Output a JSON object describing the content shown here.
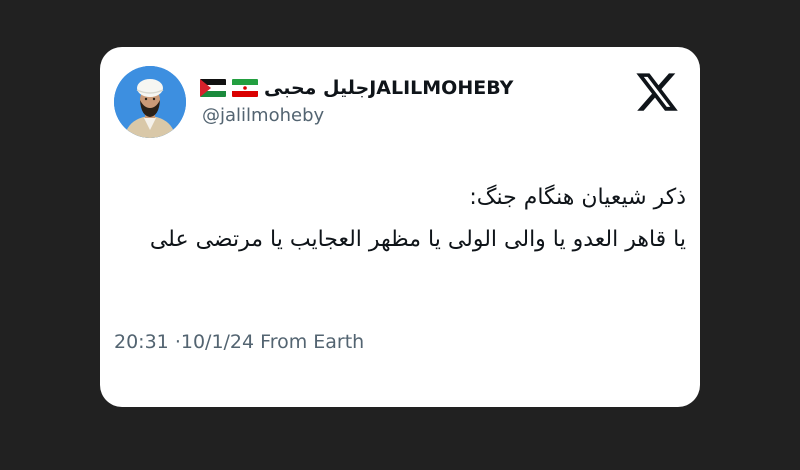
{
  "tweet": {
    "display_name": "جلیل محبیJALILMOHEBY",
    "flags": [
      "iran-flag",
      "palestine-flag"
    ],
    "handle": "@jalilmoheby",
    "text_lines": [
      "ذکر شیعیان هنگام جنگ:",
      "یا قاهر العدو یا والی الولی یا مظهر العجایب یا مرتضی علی"
    ],
    "time": "20:31",
    "separator": "·",
    "date": "10/1/24",
    "location": "From Earth"
  },
  "icons": {
    "brand": "x-logo-icon",
    "avatar": "profile-avatar"
  },
  "colors": {
    "background": "#212121",
    "card": "#ffffff",
    "text_primary": "#0f1419",
    "text_secondary": "#536471",
    "avatar_bg": "#3d8fe0"
  }
}
